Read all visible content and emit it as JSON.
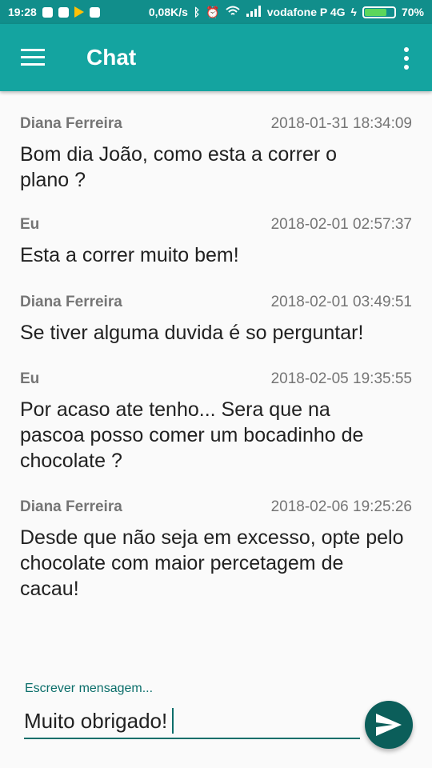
{
  "status_bar": {
    "time": "19:28",
    "network_speed": "0,08K/s",
    "carrier": "vodafone P 4G",
    "battery": "70%"
  },
  "app_bar": {
    "title": "Chat"
  },
  "messages": [
    {
      "sender": "Diana Ferreira",
      "timestamp": "2018-01-31 18:34:09",
      "text": "Bom dia João, como esta a correr o plano ?"
    },
    {
      "sender": "Eu",
      "timestamp": "2018-02-01 02:57:37",
      "text": "Esta a correr muito bem!"
    },
    {
      "sender": "Diana Ferreira",
      "timestamp": "2018-02-01 03:49:51",
      "text": "Se tiver alguma duvida é so perguntar!"
    },
    {
      "sender": "Eu",
      "timestamp": "2018-02-05 19:35:55",
      "text": "Por acaso ate tenho... Sera que na pascoa posso comer um bocadinho de chocolate ?"
    },
    {
      "sender": "Diana Ferreira",
      "timestamp": "2018-02-06 19:25:26",
      "text": "Desde que não seja em excesso, opte pelo chocolate com maior percetagem de cacau!"
    }
  ],
  "composer": {
    "label": "Escrever mensagem...",
    "value": "Muito obrigado!"
  },
  "colors": {
    "app_bar": "#14a4a0",
    "status_bar": "#118e8b",
    "accent": "#0b5e5a"
  }
}
